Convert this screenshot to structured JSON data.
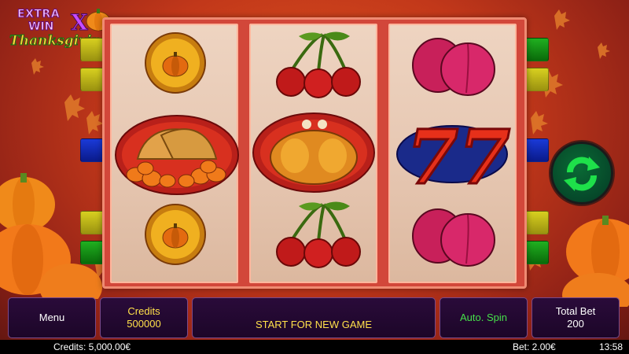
{
  "logo": {
    "line1": "EXTRA",
    "line2": "WIN",
    "x": "X",
    "subtitle": "Thanksgiving"
  },
  "reels": [
    {
      "symbols": [
        "pumpkin-coin",
        "cornucopia",
        "pumpkin-coin"
      ]
    },
    {
      "symbols": [
        "cherries",
        "roast-turkey",
        "cherries"
      ]
    },
    {
      "symbols": [
        "plums",
        "seven-seven",
        "plums"
      ]
    }
  ],
  "panel": {
    "menu_label": "Menu",
    "credits_label": "Credits",
    "credits_value": "500000",
    "message": "START FOR NEW GAME",
    "auto_spin_label": "Auto. Spin",
    "total_bet_label": "Total Bet",
    "total_bet_value": "200"
  },
  "status": {
    "credits": "Credits: 5,000.00€",
    "bet": "Bet: 2.00€",
    "time": "13:58"
  },
  "colors": {
    "accent_yellow": "#ffe04a",
    "accent_green": "#46e04a",
    "panel_bg": "#1c0628",
    "frame_red": "#d2473a"
  },
  "icons": {
    "spin": "refresh-arrows-icon"
  }
}
